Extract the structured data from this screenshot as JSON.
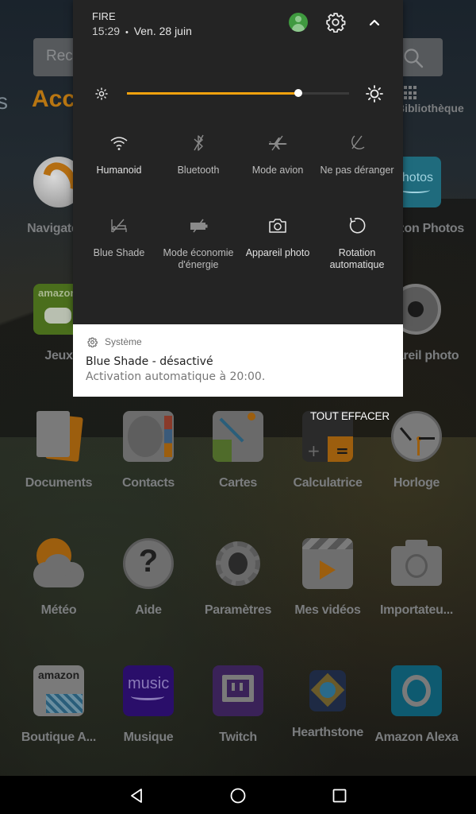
{
  "home": {
    "search_placeholder": "Rechercher",
    "tab_left_partial": "s",
    "tab_active": "Accueil",
    "library_label": "Bibliothèque",
    "accent_color": "#b87612",
    "apps_row1_partial": [
      {
        "label": "Navigateur",
        "icon": "silk-browser-icon"
      },
      {
        "label": "Amazon Photos",
        "icon": "amazon-photos-icon"
      }
    ],
    "apps_row2_partial": [
      {
        "label": "Jeux",
        "icon": "games-controller-icon"
      },
      {
        "label": "Appareil photo",
        "icon": "camera-shutter-icon"
      }
    ],
    "apps_row3": [
      {
        "label": "Documents",
        "icon": "documents-icon"
      },
      {
        "label": "Contacts",
        "icon": "contacts-icon"
      },
      {
        "label": "Cartes",
        "icon": "maps-icon"
      },
      {
        "label": "Calculatrice",
        "icon": "calculator-icon"
      },
      {
        "label": "Horloge",
        "icon": "clock-icon"
      }
    ],
    "apps_row4": [
      {
        "label": "Météo",
        "icon": "weather-icon"
      },
      {
        "label": "Aide",
        "icon": "help-icon"
      },
      {
        "label": "Paramètres",
        "icon": "settings-gear-icon"
      },
      {
        "label": "Mes vidéos",
        "icon": "videos-icon"
      },
      {
        "label": "Importateu...",
        "icon": "usb-camera-import-icon"
      }
    ],
    "apps_row5": [
      {
        "label": "Boutique A...",
        "icon": "amazon-store-icon"
      },
      {
        "label": "Musique",
        "icon": "amazon-music-icon"
      },
      {
        "label": "Twitch",
        "icon": "twitch-icon"
      },
      {
        "label": "Hearthstone",
        "icon": "hearthstone-icon"
      },
      {
        "label": "Amazon Alexa",
        "icon": "alexa-icon"
      }
    ]
  },
  "shade": {
    "device_name": "FIRE",
    "time": "15:29",
    "separator": "•",
    "date": "Ven. 28 juin",
    "brightness_level": 0.77,
    "slider_color": "#f0a10e",
    "tiles": [
      {
        "label": "Humanoid",
        "icon": "wifi-icon",
        "state": "on"
      },
      {
        "label": "Bluetooth",
        "icon": "bluetooth-off-icon",
        "state": "off"
      },
      {
        "label": "Mode avion",
        "icon": "airplane-off-icon",
        "state": "off"
      },
      {
        "label": "Ne pas déranger",
        "icon": "do-not-disturb-off-icon",
        "state": "off"
      },
      {
        "label": "Blue Shade",
        "icon": "blue-shade-off-icon",
        "state": "off"
      },
      {
        "label": "Mode économie d'énergie",
        "icon": "battery-saver-off-icon",
        "state": "off"
      },
      {
        "label": "Appareil photo",
        "icon": "camera-icon",
        "state": "on"
      },
      {
        "label": "Rotation automatique",
        "icon": "rotate-icon",
        "state": "on"
      }
    ]
  },
  "notification": {
    "app": "Système",
    "title": "Blue Shade - désactivé",
    "text": "Activation automatique à 20:00."
  },
  "clear_all_label": "TOUT EFFACER",
  "navbar": {
    "back": "back-icon",
    "home": "home-icon",
    "recents": "recents-icon"
  }
}
